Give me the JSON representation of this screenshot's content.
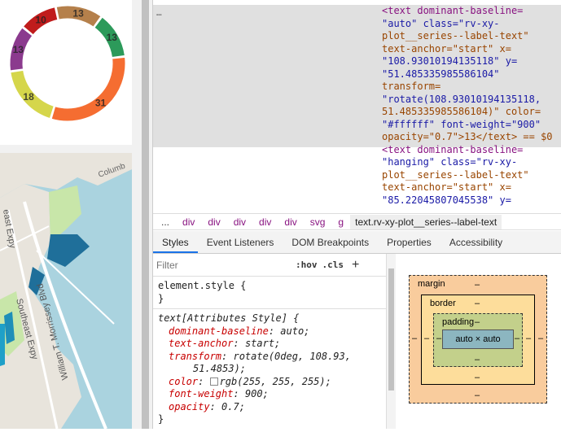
{
  "donut": {
    "labels": [
      "13",
      "13",
      "31",
      "18",
      "13",
      "10"
    ],
    "colors": {
      "brown": "#b5804b",
      "green": "#2c9a5a",
      "orange": "#f56d31",
      "lime": "#d5d64b",
      "purple": "#8b3a8e",
      "red": "#c01c1c"
    }
  },
  "map": {
    "labels": [
      "Columb",
      "east Expy",
      "William T. Morrissey Blvd",
      "Southeast Expy"
    ]
  },
  "dom": {
    "ellipsis": "…",
    "lines": [
      {
        "t": "<text dominant-baseline="
      },
      {
        "t": "\"auto\" class=\"rv-xy-"
      },
      {
        "t": "plot__series--label-text\""
      },
      {
        "t": "text-anchor=\"start\" x="
      },
      {
        "t": "\"108.93010194135118\" y="
      },
      {
        "t": "\"51.485335985586104\""
      },
      {
        "t": "transform="
      },
      {
        "t": "\"rotate(108.93010194135118,"
      },
      {
        "t": "51.485335985586104)\" color="
      },
      {
        "t": "\"#ffffff\" font-weight=\"900\""
      },
      {
        "t": "opacity=\"0.7\">13</text> == $0"
      },
      {
        "t": "<text dominant-baseline="
      },
      {
        "t": "\"hanging\" class=\"rv-xy-"
      },
      {
        "t": "plot__series--label-text\""
      },
      {
        "t": "text-anchor=\"start\" x="
      },
      {
        "t": "\"85.22045807045538\" y="
      }
    ]
  },
  "breadcrumbs": [
    "...",
    "div",
    "div",
    "div",
    "div",
    "div",
    "svg",
    "g",
    "text.rv-xy-plot__series--label-text"
  ],
  "tabs": [
    "Styles",
    "Event Listeners",
    "DOM Breakpoints",
    "Properties",
    "Accessibility"
  ],
  "styles": {
    "filter_placeholder": "Filter",
    "hov": ":hov",
    "cls": ".cls",
    "plus": "+",
    "element_style_open": "element.style {",
    "close": "}",
    "attr_rule_open": "text[Attributes Style] {",
    "props": [
      {
        "name": "dominant-baseline",
        "value": "auto;"
      },
      {
        "name": "text-anchor",
        "value": "start;"
      },
      {
        "name": "transform",
        "value": "rotate(0deg, 108.93,"
      },
      {
        "name": "",
        "value": "51.4853);"
      },
      {
        "name": "color",
        "value": "rgb(255, 255, 255);"
      },
      {
        "name": "font-weight",
        "value": "900;"
      },
      {
        "name": "opacity",
        "value": "0.7;"
      }
    ]
  },
  "boxmodel": {
    "margin": "margin",
    "border": "border",
    "padding": "padding",
    "content": "auto × auto",
    "dash": "–"
  }
}
